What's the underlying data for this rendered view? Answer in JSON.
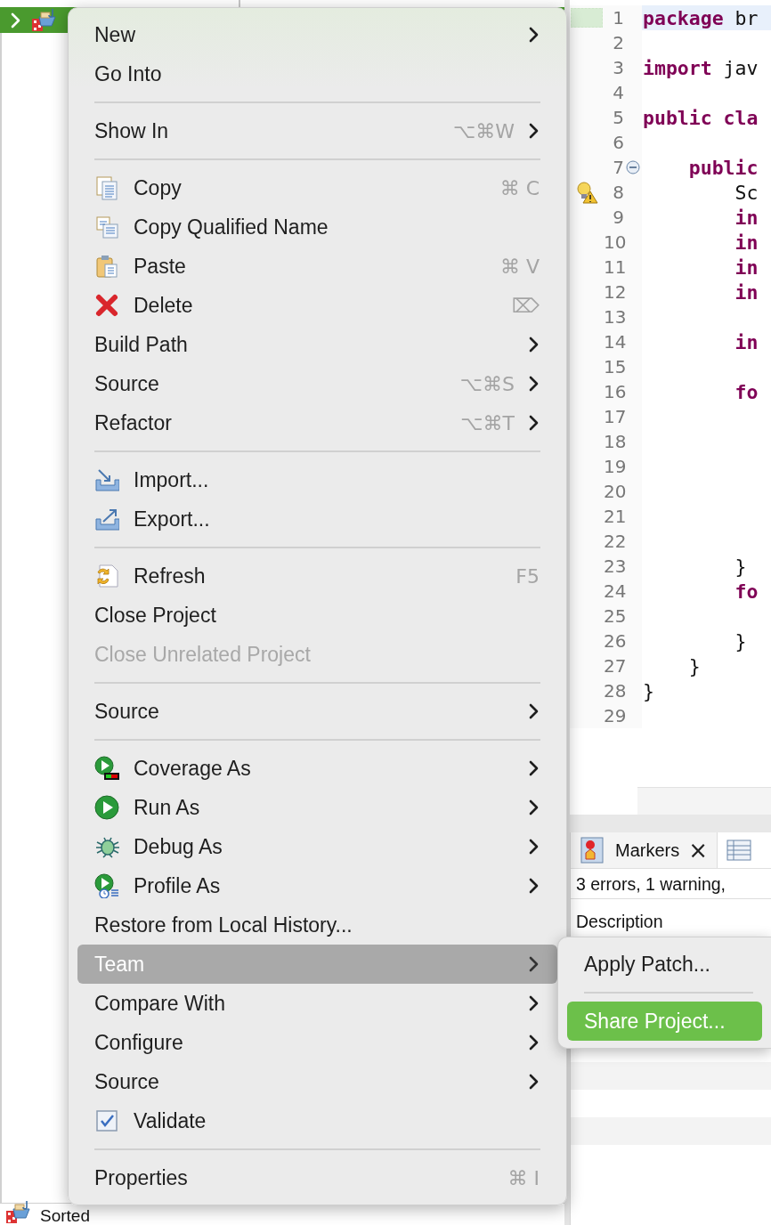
{
  "explorer": {
    "footer_label": "Sorted"
  },
  "editor": {
    "lines": [
      {
        "number": "1",
        "current": true,
        "tokens": [
          {
            "kind": "keyword",
            "text": "package"
          },
          {
            "kind": "plain",
            "text": " br"
          }
        ]
      },
      {
        "number": "2",
        "current": false
      },
      {
        "number": "3",
        "current": false,
        "tokens": [
          {
            "kind": "keyword",
            "text": "import"
          },
          {
            "kind": "plain",
            "text": " jav"
          }
        ]
      },
      {
        "number": "4",
        "current": false
      },
      {
        "number": "5",
        "current": false,
        "tokens": [
          {
            "kind": "keyword",
            "text": "public cla"
          }
        ]
      },
      {
        "number": "6",
        "current": false
      },
      {
        "number": "7",
        "current": false,
        "tokens": [
          {
            "kind": "keyword",
            "text": "    public"
          }
        ]
      },
      {
        "number": "8",
        "current": false,
        "tokens": [
          {
            "kind": "plain",
            "text": "        Sc"
          }
        ]
      },
      {
        "number": "9",
        "current": false,
        "tokens": [
          {
            "kind": "keyword",
            "text": "        in"
          }
        ]
      },
      {
        "number": "10",
        "current": false,
        "tokens": [
          {
            "kind": "keyword",
            "text": "        in"
          }
        ]
      },
      {
        "number": "11",
        "current": false,
        "tokens": [
          {
            "kind": "keyword",
            "text": "        in"
          }
        ]
      },
      {
        "number": "12",
        "current": false,
        "tokens": [
          {
            "kind": "keyword",
            "text": "        in"
          }
        ]
      },
      {
        "number": "13",
        "current": false
      },
      {
        "number": "14",
        "current": false,
        "tokens": [
          {
            "kind": "keyword",
            "text": "        in"
          }
        ]
      },
      {
        "number": "15",
        "current": false
      },
      {
        "number": "16",
        "current": false,
        "tokens": [
          {
            "kind": "keyword",
            "text": "        fo"
          }
        ]
      },
      {
        "number": "17",
        "current": false
      },
      {
        "number": "18",
        "current": false
      },
      {
        "number": "19",
        "current": false
      },
      {
        "number": "20",
        "current": false
      },
      {
        "number": "21",
        "current": false
      },
      {
        "number": "22",
        "current": false
      },
      {
        "number": "23",
        "current": false,
        "tokens": [
          {
            "kind": "plain",
            "text": "        }"
          }
        ]
      },
      {
        "number": "24",
        "current": false,
        "tokens": [
          {
            "kind": "keyword",
            "text": "        fo"
          }
        ]
      },
      {
        "number": "25",
        "current": false
      },
      {
        "number": "26",
        "current": false,
        "tokens": [
          {
            "kind": "plain",
            "text": "        }"
          }
        ]
      },
      {
        "number": "27",
        "current": false,
        "tokens": [
          {
            "kind": "plain",
            "text": "    }"
          }
        ]
      },
      {
        "number": "28",
        "current": false,
        "tokens": [
          {
            "kind": "plain",
            "text": "}"
          }
        ]
      },
      {
        "number": "29",
        "current": false
      }
    ]
  },
  "markers": {
    "tab_label": "Markers",
    "close": "×",
    "summary": "3 errors, 1 warning,",
    "column": "Description"
  },
  "context_menu": {
    "entries": [
      {
        "kind": "item",
        "label": "New",
        "submenu": true,
        "selected": false,
        "disabled": false
      },
      {
        "kind": "item",
        "label": "Go Into",
        "submenu": false,
        "selected": false,
        "disabled": false
      },
      {
        "kind": "separator"
      },
      {
        "kind": "item",
        "label": "Show In",
        "shortcut": "⌥⌘W",
        "submenu": true,
        "selected": false,
        "disabled": false
      },
      {
        "kind": "separator"
      },
      {
        "kind": "item",
        "label": "Copy",
        "shortcut": "⌘ C",
        "submenu": false,
        "selected": false,
        "disabled": false
      },
      {
        "kind": "item",
        "label": "Copy Qualified Name",
        "submenu": false,
        "selected": false,
        "disabled": false
      },
      {
        "kind": "item",
        "label": "Paste",
        "shortcut": "⌘ V",
        "submenu": false,
        "selected": false,
        "disabled": false
      },
      {
        "kind": "item",
        "label": "Delete",
        "shortcut": "⌦",
        "submenu": false,
        "selected": false,
        "disabled": false
      },
      {
        "kind": "item",
        "label": "Build Path",
        "submenu": true,
        "selected": false,
        "disabled": false
      },
      {
        "kind": "item",
        "label": "Source",
        "shortcut": "⌥⌘S",
        "submenu": true,
        "selected": false,
        "disabled": false
      },
      {
        "kind": "item",
        "label": "Refactor",
        "shortcut": "⌥⌘T",
        "submenu": true,
        "selected": false,
        "disabled": false
      },
      {
        "kind": "separator"
      },
      {
        "kind": "item",
        "label": "Import...",
        "submenu": false,
        "selected": false,
        "disabled": false
      },
      {
        "kind": "item",
        "label": "Export...",
        "submenu": false,
        "selected": false,
        "disabled": false
      },
      {
        "kind": "separator"
      },
      {
        "kind": "item",
        "label": "Refresh",
        "shortcut": "F5",
        "submenu": false,
        "selected": false,
        "disabled": false
      },
      {
        "kind": "item",
        "label": "Close Project",
        "submenu": false,
        "selected": false,
        "disabled": false
      },
      {
        "kind": "item",
        "label": "Close Unrelated Project",
        "submenu": false,
        "selected": false,
        "disabled": true
      },
      {
        "kind": "separator"
      },
      {
        "kind": "item",
        "label": "Source",
        "submenu": true,
        "selected": false,
        "disabled": false
      },
      {
        "kind": "separator"
      },
      {
        "kind": "item",
        "label": "Coverage As",
        "submenu": true,
        "selected": false,
        "disabled": false
      },
      {
        "kind": "item",
        "label": "Run As",
        "submenu": true,
        "selected": false,
        "disabled": false
      },
      {
        "kind": "item",
        "label": "Debug As",
        "submenu": true,
        "selected": false,
        "disabled": false
      },
      {
        "kind": "item",
        "label": "Profile As",
        "submenu": true,
        "selected": false,
        "disabled": false
      },
      {
        "kind": "item",
        "label": "Restore from Local History...",
        "submenu": false,
        "selected": false,
        "disabled": false
      },
      {
        "kind": "item",
        "label": "Team",
        "submenu": true,
        "selected": true,
        "disabled": false
      },
      {
        "kind": "item",
        "label": "Compare With",
        "submenu": true,
        "selected": false,
        "disabled": false
      },
      {
        "kind": "item",
        "label": "Configure",
        "submenu": true,
        "selected": false,
        "disabled": false
      },
      {
        "kind": "item",
        "label": "Source",
        "submenu": true,
        "selected": false,
        "disabled": false
      },
      {
        "kind": "item",
        "label": "Validate",
        "submenu": false,
        "selected": false,
        "disabled": false
      },
      {
        "kind": "separator"
      },
      {
        "kind": "item",
        "label": "Properties",
        "shortcut": "⌘ I",
        "submenu": false,
        "selected": false,
        "disabled": false
      }
    ]
  },
  "submenu": {
    "entries": [
      {
        "kind": "item",
        "label": "Apply Patch...",
        "selected": false
      },
      {
        "kind": "separator"
      },
      {
        "kind": "item",
        "label": "Share Project...",
        "selected": true
      }
    ]
  }
}
